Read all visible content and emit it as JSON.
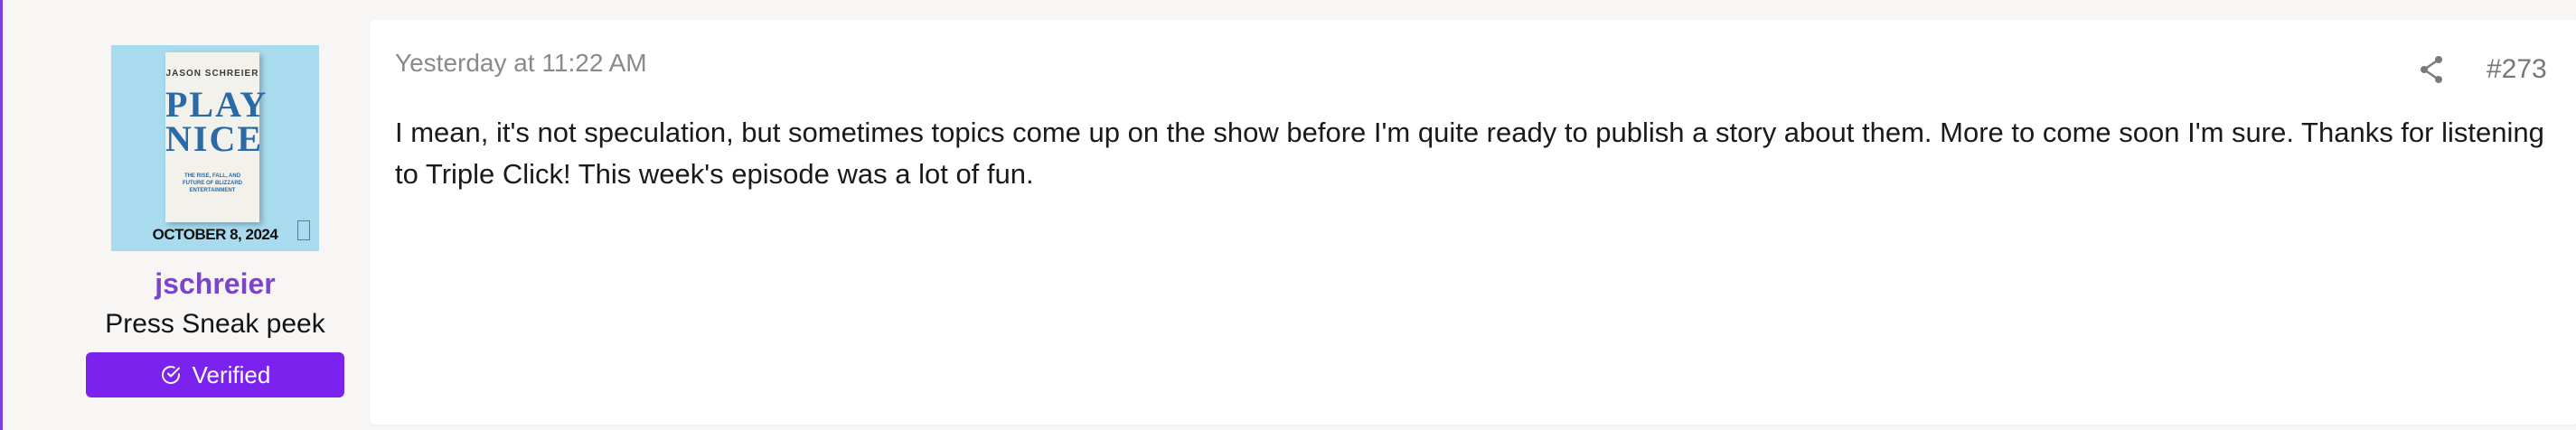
{
  "user": {
    "avatar": {
      "book_author": "JASON SCHREIER",
      "book_title_line1": "PLAY",
      "book_title_line2": "NICE",
      "book_subtitle": "THE RISE, FALL, AND FUTURE OF BLIZZARD ENTERTAINMENT",
      "release_date": "OCTOBER 8, 2024"
    },
    "username": "jschreier",
    "title": "Press Sneak peek",
    "badge": {
      "label": "Verified",
      "icon": "check-circle-icon",
      "color": "#7b22ee"
    }
  },
  "post": {
    "timestamp": "Yesterday at 11:22 AM",
    "share_icon": "share-icon",
    "number": "#273",
    "body": "I mean, it's not speculation, but sometimes topics come up on the show before I'm quite ready to publish a story about them. More to come soon I'm sure. Thanks for listening to Triple Click! This week's episode was a lot of fun."
  },
  "colors": {
    "accent": "#7b3fe4",
    "username": "#7a45c8",
    "background": "#f7f6f4"
  }
}
